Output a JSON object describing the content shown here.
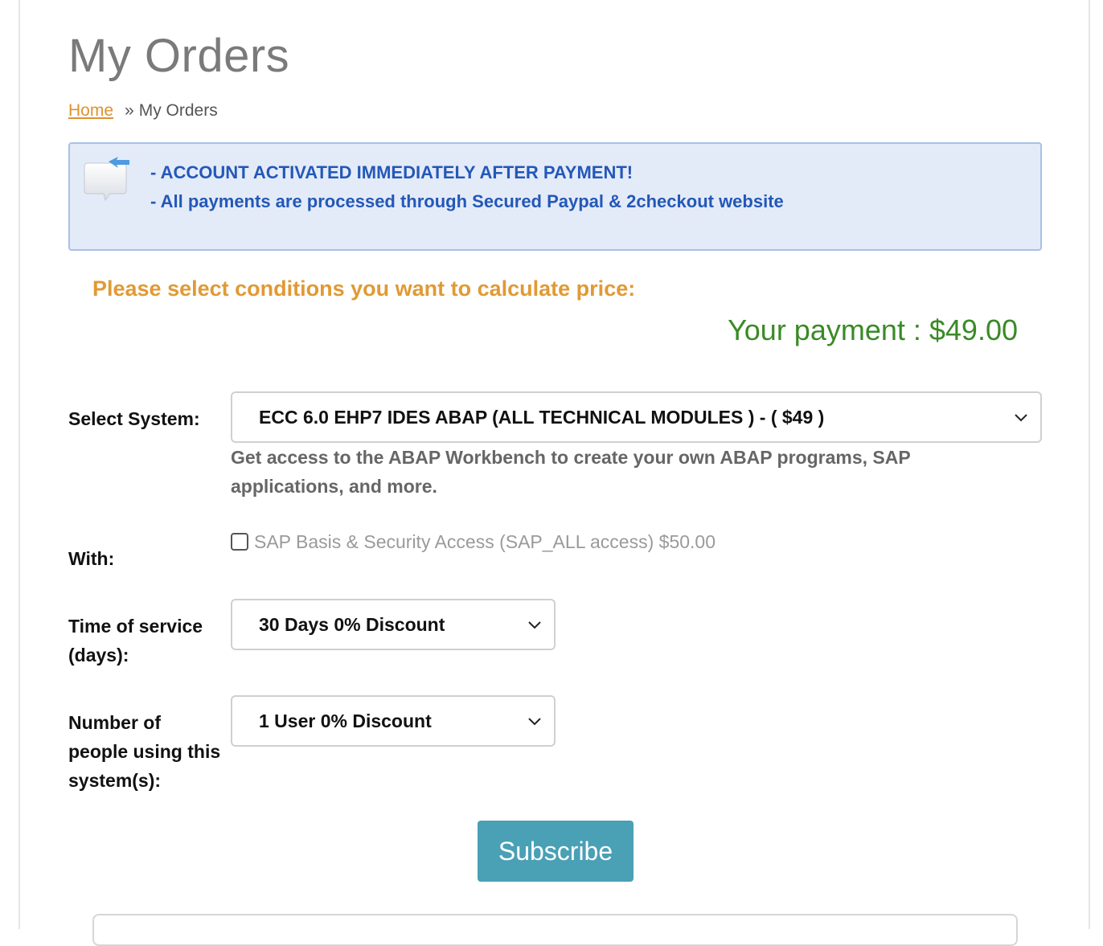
{
  "page": {
    "title": "My Orders"
  },
  "breadcrumb": {
    "home": "Home",
    "separator": "»",
    "current": "My Orders"
  },
  "notice": {
    "icon": "speech-bubble-icon",
    "line1": "- ACCOUNT ACTIVATED IMMEDIATELY AFTER PAYMENT!",
    "line2": "- All payments are processed through Secured Paypal & 2checkout website"
  },
  "conditions_heading": "Please select conditions you want to calculate price:",
  "payment": {
    "label": "Your payment : $49.00"
  },
  "form": {
    "system": {
      "label": "Select System:",
      "selected": "ECC 6.0 EHP7 IDES ABAP (ALL TECHNICAL MODULES ) - ( $49 )",
      "description": "Get access to the ABAP Workbench to create your own ABAP programs, SAP applications, and more."
    },
    "with": {
      "label": "With:",
      "addon_label": "SAP Basis & Security Access (SAP_ALL access) $50.00",
      "checked": false
    },
    "time": {
      "label_line1": "Time of service",
      "label_line2": "(days):",
      "selected": "30 Days 0% Discount"
    },
    "users": {
      "label_line1": "Number of",
      "label_line2": "people using this",
      "label_line3": "system(s):",
      "selected": "1 User 0% Discount"
    },
    "subscribe_label": "Subscribe"
  },
  "colors": {
    "accent_orange": "#e09a34",
    "payment_green": "#3a8a26",
    "notice_blue": "#2358b8",
    "button_teal": "#4aa0b5"
  }
}
